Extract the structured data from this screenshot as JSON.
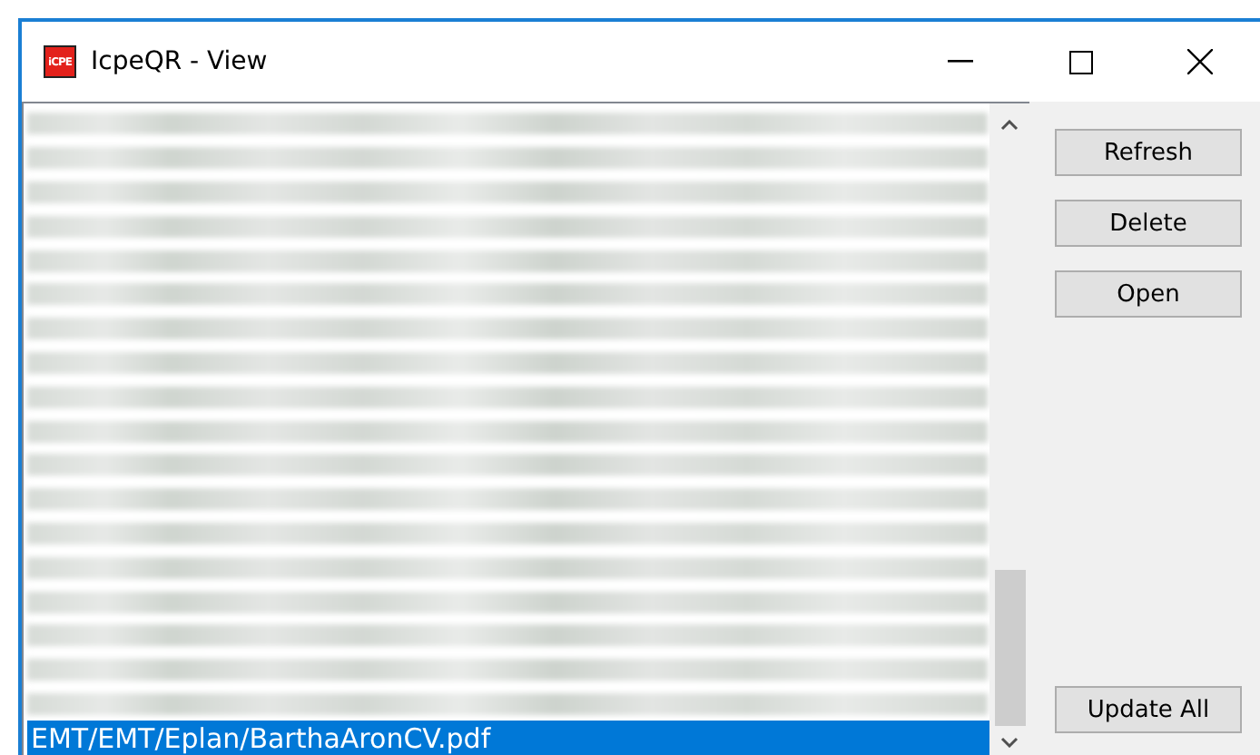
{
  "window": {
    "title": "IcpeQR - View",
    "icon_text": "iCPE"
  },
  "list": {
    "rows": [
      {
        "kind": "blurred",
        "selected": false
      },
      {
        "kind": "blurred",
        "selected": false
      },
      {
        "kind": "blurred",
        "selected": false
      },
      {
        "kind": "blurred",
        "selected": false
      },
      {
        "kind": "blurred",
        "selected": false
      },
      {
        "kind": "blurred",
        "selected": false
      },
      {
        "kind": "blurred",
        "selected": false
      },
      {
        "kind": "blurred",
        "selected": false
      },
      {
        "kind": "blurred",
        "selected": false
      },
      {
        "kind": "blurred",
        "selected": false
      },
      {
        "kind": "blurred",
        "selected": false
      },
      {
        "kind": "blurred",
        "selected": false
      },
      {
        "kind": "blurred",
        "selected": false
      },
      {
        "kind": "blurred",
        "selected": false
      },
      {
        "kind": "blurred",
        "selected": false
      },
      {
        "kind": "blurred",
        "selected": false
      },
      {
        "kind": "blurred",
        "selected": false
      },
      {
        "kind": "blurred",
        "selected": false
      },
      {
        "kind": "text",
        "text": "EMT/EMT/Eplan/BarthaAronCV.pdf",
        "selected": true
      }
    ]
  },
  "buttons": [
    "Refresh",
    "Delete",
    "Open"
  ],
  "bottom_button": "Update All"
}
